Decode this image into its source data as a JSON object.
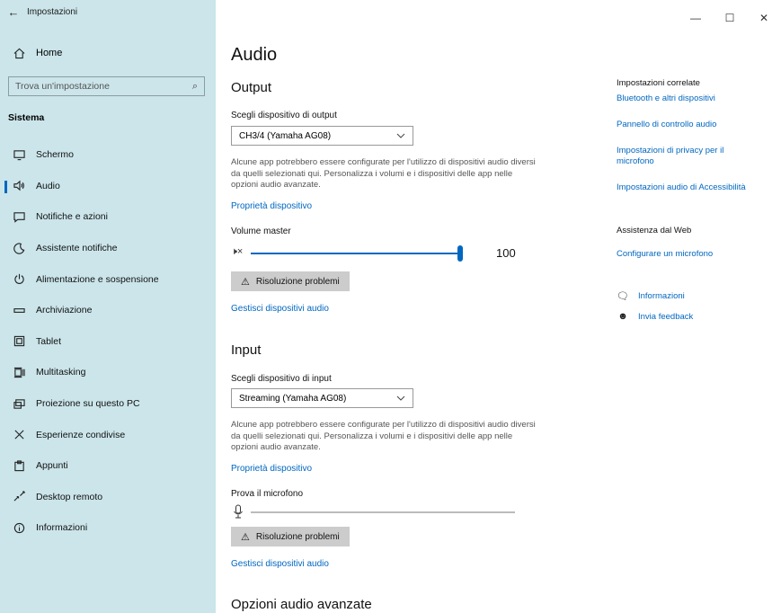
{
  "window": {
    "title": "Impostazioni",
    "back": "←",
    "minimize": "—",
    "maximize": "☐",
    "close": "✕"
  },
  "sidebar": {
    "home": "Home",
    "search_placeholder": "Trova un'impostazione",
    "section": "Sistema",
    "items": [
      {
        "label": "Schermo",
        "icon": "monitor-icon"
      },
      {
        "label": "Audio",
        "icon": "speaker-icon",
        "active": true
      },
      {
        "label": "Notifiche e azioni",
        "icon": "notification-icon"
      },
      {
        "label": "Assistente notifiche",
        "icon": "moon-icon"
      },
      {
        "label": "Alimentazione e sospensione",
        "icon": "power-icon"
      },
      {
        "label": "Archiviazione",
        "icon": "storage-icon"
      },
      {
        "label": "Tablet",
        "icon": "tablet-icon"
      },
      {
        "label": "Multitasking",
        "icon": "multitasking-icon"
      },
      {
        "label": "Proiezione su questo PC",
        "icon": "projection-icon"
      },
      {
        "label": "Esperienze condivise",
        "icon": "shared-icon"
      },
      {
        "label": "Appunti",
        "icon": "clipboard-icon"
      },
      {
        "label": "Desktop remoto",
        "icon": "remote-desktop-icon"
      },
      {
        "label": "Informazioni",
        "icon": "info-icon"
      }
    ]
  },
  "main": {
    "title": "Audio",
    "output": {
      "heading": "Output",
      "device_label": "Scegli dispositivo di output",
      "device_value": "CH3/4 (Yamaha AG08)",
      "desc": "Alcune app potrebbero essere configurate per l'utilizzo di dispositivi audio diversi da quelli selezionati qui. Personalizza i volumi e i dispositivi delle app nelle opzioni audio avanzate.",
      "properties_link": "Proprietà dispositivo",
      "volume_label": "Volume master",
      "volume_value": "100",
      "speaker_glyph": "🕨×",
      "troubleshoot": "Risoluzione problemi",
      "manage_link": "Gestisci dispositivi audio"
    },
    "input": {
      "heading": "Input",
      "device_label": "Scegli dispositivo di input",
      "device_value": "Streaming (Yamaha AG08)",
      "desc": "Alcune app potrebbero essere configurate per l'utilizzo di dispositivi audio diversi da quelli selezionati qui. Personalizza i volumi e i dispositivi delle app nelle opzioni audio avanzate.",
      "properties_link": "Proprietà dispositivo",
      "test_label": "Prova il microfono",
      "troubleshoot": "Risoluzione problemi",
      "manage_link": "Gestisci dispositivi audio"
    },
    "advanced_heading": "Opzioni audio avanzate"
  },
  "right": {
    "related_heading": "Impostazioni correlate",
    "related_links": [
      "Bluetooth e altri dispositivi",
      "Pannello di controllo audio",
      "Impostazioni di privacy per il microfono",
      "Impostazioni audio di Accessibilità"
    ],
    "web_heading": "Assistenza dal Web",
    "web_link": "Configurare un microfono",
    "help": [
      {
        "label": "Informazioni",
        "icon": "help-chat-icon"
      },
      {
        "label": "Invia feedback",
        "icon": "feedback-icon"
      }
    ]
  },
  "colors": {
    "sidebar_bg": "#cbe5ea",
    "accent": "#0067c0"
  }
}
